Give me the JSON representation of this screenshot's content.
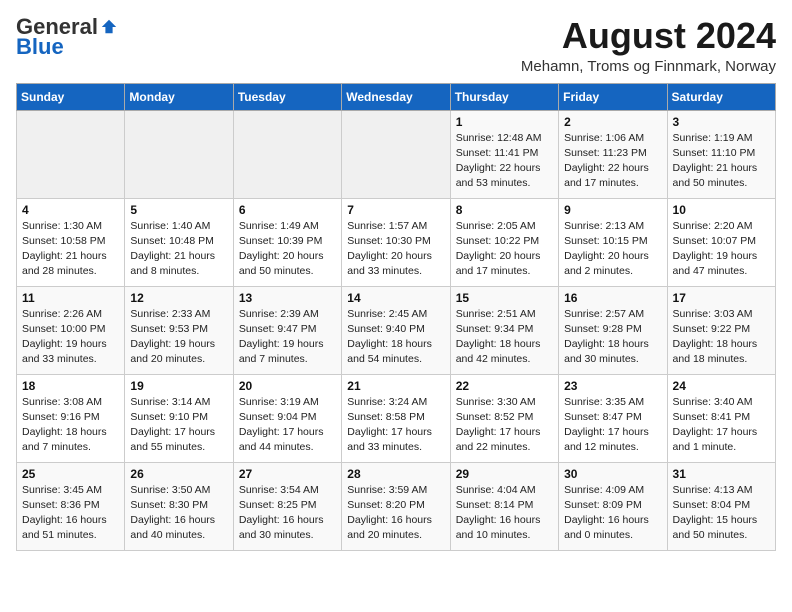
{
  "header": {
    "logo_general": "General",
    "logo_blue": "Blue",
    "main_title": "August 2024",
    "subtitle": "Mehamn, Troms og Finnmark, Norway"
  },
  "weekdays": [
    "Sunday",
    "Monday",
    "Tuesday",
    "Wednesday",
    "Thursday",
    "Friday",
    "Saturday"
  ],
  "weeks": [
    [
      {
        "day": "",
        "info": ""
      },
      {
        "day": "",
        "info": ""
      },
      {
        "day": "",
        "info": ""
      },
      {
        "day": "",
        "info": ""
      },
      {
        "day": "1",
        "info": "Sunrise: 12:48 AM\nSunset: 11:41 PM\nDaylight: 22 hours\nand 53 minutes."
      },
      {
        "day": "2",
        "info": "Sunrise: 1:06 AM\nSunset: 11:23 PM\nDaylight: 22 hours\nand 17 minutes."
      },
      {
        "day": "3",
        "info": "Sunrise: 1:19 AM\nSunset: 11:10 PM\nDaylight: 21 hours\nand 50 minutes."
      }
    ],
    [
      {
        "day": "4",
        "info": "Sunrise: 1:30 AM\nSunset: 10:58 PM\nDaylight: 21 hours\nand 28 minutes."
      },
      {
        "day": "5",
        "info": "Sunrise: 1:40 AM\nSunset: 10:48 PM\nDaylight: 21 hours\nand 8 minutes."
      },
      {
        "day": "6",
        "info": "Sunrise: 1:49 AM\nSunset: 10:39 PM\nDaylight: 20 hours\nand 50 minutes."
      },
      {
        "day": "7",
        "info": "Sunrise: 1:57 AM\nSunset: 10:30 PM\nDaylight: 20 hours\nand 33 minutes."
      },
      {
        "day": "8",
        "info": "Sunrise: 2:05 AM\nSunset: 10:22 PM\nDaylight: 20 hours\nand 17 minutes."
      },
      {
        "day": "9",
        "info": "Sunrise: 2:13 AM\nSunset: 10:15 PM\nDaylight: 20 hours\nand 2 minutes."
      },
      {
        "day": "10",
        "info": "Sunrise: 2:20 AM\nSunset: 10:07 PM\nDaylight: 19 hours\nand 47 minutes."
      }
    ],
    [
      {
        "day": "11",
        "info": "Sunrise: 2:26 AM\nSunset: 10:00 PM\nDaylight: 19 hours\nand 33 minutes."
      },
      {
        "day": "12",
        "info": "Sunrise: 2:33 AM\nSunset: 9:53 PM\nDaylight: 19 hours\nand 20 minutes."
      },
      {
        "day": "13",
        "info": "Sunrise: 2:39 AM\nSunset: 9:47 PM\nDaylight: 19 hours\nand 7 minutes."
      },
      {
        "day": "14",
        "info": "Sunrise: 2:45 AM\nSunset: 9:40 PM\nDaylight: 18 hours\nand 54 minutes."
      },
      {
        "day": "15",
        "info": "Sunrise: 2:51 AM\nSunset: 9:34 PM\nDaylight: 18 hours\nand 42 minutes."
      },
      {
        "day": "16",
        "info": "Sunrise: 2:57 AM\nSunset: 9:28 PM\nDaylight: 18 hours\nand 30 minutes."
      },
      {
        "day": "17",
        "info": "Sunrise: 3:03 AM\nSunset: 9:22 PM\nDaylight: 18 hours\nand 18 minutes."
      }
    ],
    [
      {
        "day": "18",
        "info": "Sunrise: 3:08 AM\nSunset: 9:16 PM\nDaylight: 18 hours\nand 7 minutes."
      },
      {
        "day": "19",
        "info": "Sunrise: 3:14 AM\nSunset: 9:10 PM\nDaylight: 17 hours\nand 55 minutes."
      },
      {
        "day": "20",
        "info": "Sunrise: 3:19 AM\nSunset: 9:04 PM\nDaylight: 17 hours\nand 44 minutes."
      },
      {
        "day": "21",
        "info": "Sunrise: 3:24 AM\nSunset: 8:58 PM\nDaylight: 17 hours\nand 33 minutes."
      },
      {
        "day": "22",
        "info": "Sunrise: 3:30 AM\nSunset: 8:52 PM\nDaylight: 17 hours\nand 22 minutes."
      },
      {
        "day": "23",
        "info": "Sunrise: 3:35 AM\nSunset: 8:47 PM\nDaylight: 17 hours\nand 12 minutes."
      },
      {
        "day": "24",
        "info": "Sunrise: 3:40 AM\nSunset: 8:41 PM\nDaylight: 17 hours\nand 1 minute."
      }
    ],
    [
      {
        "day": "25",
        "info": "Sunrise: 3:45 AM\nSunset: 8:36 PM\nDaylight: 16 hours\nand 51 minutes."
      },
      {
        "day": "26",
        "info": "Sunrise: 3:50 AM\nSunset: 8:30 PM\nDaylight: 16 hours\nand 40 minutes."
      },
      {
        "day": "27",
        "info": "Sunrise: 3:54 AM\nSunset: 8:25 PM\nDaylight: 16 hours\nand 30 minutes."
      },
      {
        "day": "28",
        "info": "Sunrise: 3:59 AM\nSunset: 8:20 PM\nDaylight: 16 hours\nand 20 minutes."
      },
      {
        "day": "29",
        "info": "Sunrise: 4:04 AM\nSunset: 8:14 PM\nDaylight: 16 hours\nand 10 minutes."
      },
      {
        "day": "30",
        "info": "Sunrise: 4:09 AM\nSunset: 8:09 PM\nDaylight: 16 hours\nand 0 minutes."
      },
      {
        "day": "31",
        "info": "Sunrise: 4:13 AM\nSunset: 8:04 PM\nDaylight: 15 hours\nand 50 minutes."
      }
    ]
  ]
}
